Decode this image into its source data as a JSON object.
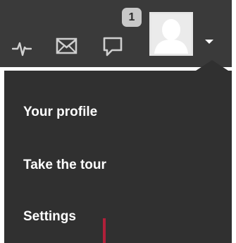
{
  "header": {
    "activity_icon": "activity-pulse-icon",
    "mail_icon": "envelope-icon",
    "chat_icon": "chat-bubble-icon",
    "notification_count": "1",
    "avatar_icon": "default-user-avatar",
    "menu_toggle_icon": "caret-down-icon"
  },
  "menu": {
    "items": [
      {
        "label": "Your profile"
      },
      {
        "label": "Take the tour"
      },
      {
        "label": "Settings"
      }
    ]
  },
  "colors": {
    "topbar": "#3a3a3a",
    "menu": "#303030",
    "badge": "#c8c8c8",
    "text": "#ffffff",
    "cursor_marker": "#b0203a"
  }
}
